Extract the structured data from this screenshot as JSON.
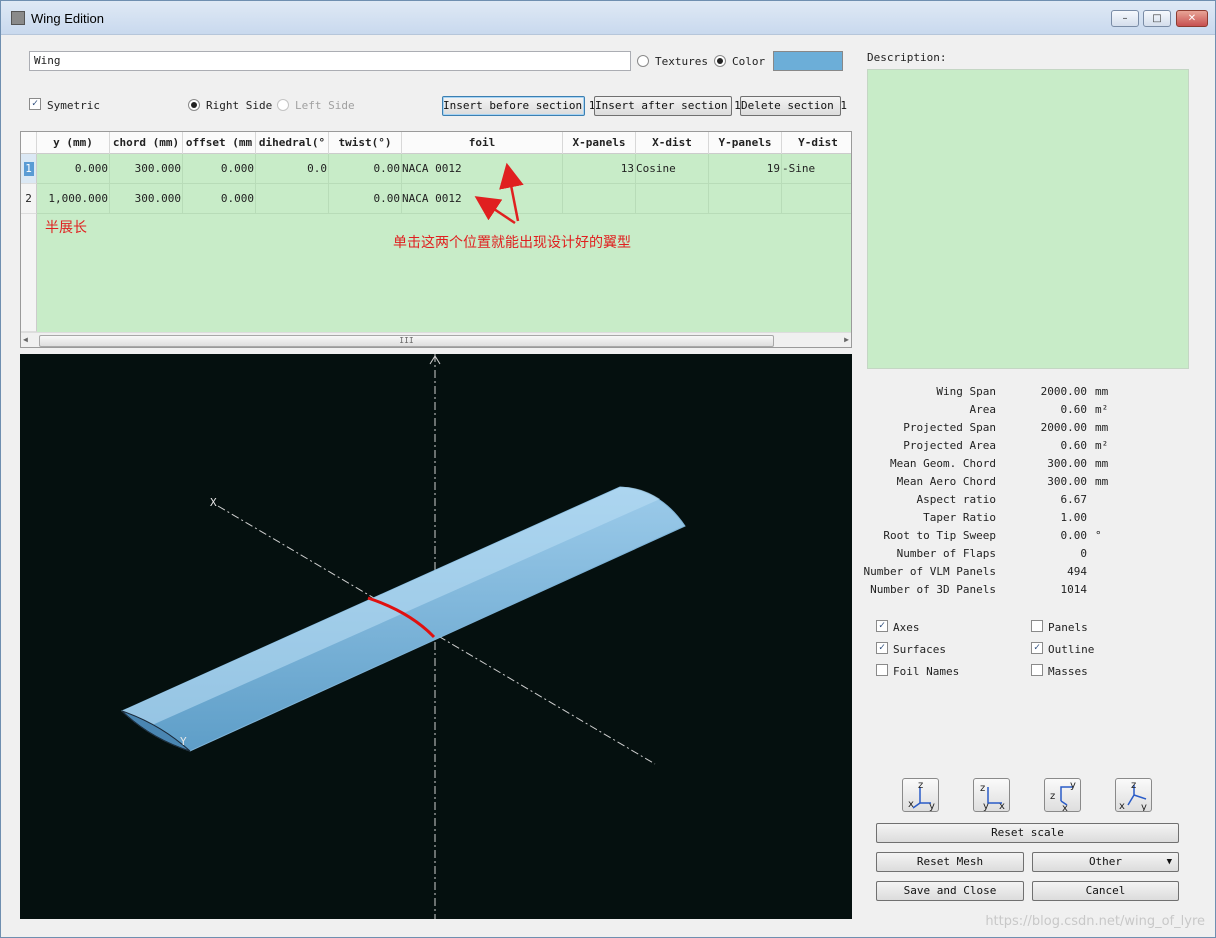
{
  "window": {
    "title": "Wing Edition",
    "minimize": "–",
    "maximize": "□",
    "close": "✕"
  },
  "top": {
    "name_value": "Wing",
    "textures_label": "Textures",
    "color_label": "Color",
    "symetric_label": "Symetric",
    "right_side_label": "Right Side",
    "left_side_label": "Left Side",
    "insert_before_label": "Insert before section 1",
    "insert_after_label": "Insert after section 1",
    "delete_label": "Delete section 1",
    "color_value": "#6caed8"
  },
  "table": {
    "headers": [
      "y (mm)",
      "chord (mm)",
      "offset (mm",
      "dihedral(°",
      "twist(°)",
      "foil",
      "X-panels",
      "X-dist",
      "Y-panels",
      "Y-dist"
    ],
    "rows": [
      {
        "num": "1",
        "y": "0.000",
        "chord": "300.000",
        "offset": "0.000",
        "dihedral": "0.0",
        "twist": "0.00",
        "foil": "NACA 0012",
        "xpanels": "13",
        "xdist": "Cosine",
        "ypanels": "19",
        "ydist": "-Sine"
      },
      {
        "num": "2",
        "y": "1,000.000",
        "chord": "300.000",
        "offset": "0.000",
        "dihedral": "",
        "twist": "0.00",
        "foil": "NACA 0012",
        "xpanels": "",
        "xdist": "",
        "ypanels": "",
        "ydist": ""
      }
    ],
    "scroll_grip": "III"
  },
  "annotations": {
    "half_span": "半展长",
    "click_hint": "单击这两个位置就能出现设计好的翼型"
  },
  "viewer": {
    "axis_x": "X",
    "axis_y": "Y"
  },
  "description_label": "Description:",
  "stats": [
    {
      "label": "Wing Span",
      "value": "2000.00",
      "unit": "mm"
    },
    {
      "label": "Area",
      "value": "0.60",
      "unit": "m²"
    },
    {
      "label": "Projected Span",
      "value": "2000.00",
      "unit": "mm"
    },
    {
      "label": "Projected Area",
      "value": "0.60",
      "unit": "m²"
    },
    {
      "label": "Mean Geom. Chord",
      "value": "300.00",
      "unit": "mm"
    },
    {
      "label": "Mean Aero Chord",
      "value": "300.00",
      "unit": "mm"
    },
    {
      "label": "Aspect ratio",
      "value": "6.67",
      "unit": ""
    },
    {
      "label": "Taper Ratio",
      "value": "1.00",
      "unit": ""
    },
    {
      "label": "Root to Tip Sweep",
      "value": "0.00",
      "unit": "°"
    },
    {
      "label": "Number of Flaps",
      "value": "0",
      "unit": ""
    },
    {
      "label": "Number of VLM Panels",
      "value": "494",
      "unit": ""
    },
    {
      "label": "Number of 3D Panels",
      "value": "1014",
      "unit": ""
    }
  ],
  "checks": {
    "axes": "Axes",
    "panels": "Panels",
    "surfaces": "Surfaces",
    "outline": "Outline",
    "foil_names": "Foil Names",
    "masses": "Masses"
  },
  "view_buttons": [
    {
      "top": "z",
      "left": "x",
      "right": "y"
    },
    {
      "top": "z",
      "left": "y",
      "right": "x"
    },
    {
      "top": "y",
      "left": "z",
      "right": "x"
    },
    {
      "top": "z",
      "left": "x",
      "right": "y"
    }
  ],
  "buttons": {
    "reset_scale": "Reset scale",
    "reset_mesh": "Reset Mesh",
    "other": "Other",
    "save_close": "Save and Close",
    "cancel": "Cancel"
  },
  "watermark": "https://blog.csdn.net/wing_of_lyre"
}
